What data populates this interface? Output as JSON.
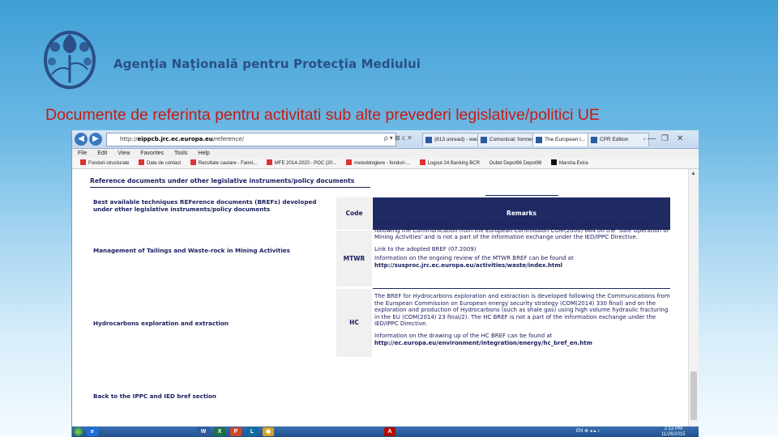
{
  "header": {
    "agency_name": "Agenţia Naţională pentru Protecţia Mediului"
  },
  "slide": {
    "title": "Documente de referinta pentru activitati sub alte prevederi legislative/politici UE"
  },
  "browser": {
    "url_prefix": "http://",
    "url_host": "eippcb.jrc.ec.europa.eu",
    "url_path": "/reference/",
    "url_controls": "ρ ▾ ⊠ c ✕",
    "tabs": [
      {
        "label": "(813 unread) - wed"
      },
      {
        "label": "Comunicat: former I..."
      },
      {
        "label": "The European I..."
      },
      {
        "label": "CPR Edition"
      }
    ],
    "window_controls": [
      "—",
      "❐",
      "✕"
    ],
    "menu": [
      "File",
      "Edit",
      "View",
      "Favorites",
      "Tools",
      "Help"
    ],
    "favorites": [
      "Fonduri-structurale",
      "Date de contact",
      "Rezultate cautare - Fanni...",
      "MFE 2014-2020 - POC (20...",
      "metodologiere - fonduri-...",
      "Logout 24 Banking BCR",
      "Outlet Depot96 Depot96",
      "Marsha Extra"
    ]
  },
  "page": {
    "heading": "Reference documents under other legislative instruments/policy documents",
    "bref_label": "Best available techniques REFerence documents (BREFs) developed under other legislative instruments/policy documents",
    "table_headers": {
      "code": "Code",
      "remarks": "Remarks"
    },
    "rows": [
      {
        "label": "Management of Tailings and Waste-rock in Mining Activities",
        "code": "MTWR",
        "remarks_1": "The BREF for Management of Tailings and Waste-Rock in Mining Activities (MTWR) was developed following the Communication from the European Commission COM(2000) 664 on the 'Safe Operation of Mining Activities' and is not a part of the information exchange under the IED/IPPC Directive.",
        "remarks_2": "Link to the adopted BREF (07.2009)",
        "remarks_3": "Information on the ongoing review of the MTWR BREF can be found at",
        "link": "http://susproc.jrc.ec.europa.eu/activities/waste/index.html"
      },
      {
        "label": "Hydrocarbons exploration and extraction",
        "code": "HC",
        "remarks_1": "The BREF for Hydrocarbons exploration and extraction is developed following the Communications from the European Commission on European energy security strategy (COM(2014) 330 final) and on the exploration and production of Hydrocarbons (such as shale gas) using high volume hydraulic fracturing in the EU (COM(2014) 23 final/2). The HC BREF is not a part of the information exchange under the IED/IPPC Directive.",
        "remarks_2": "Information on the drawing up of the HC BREF can be found at",
        "link": "http://ec.europa.eu/environment/integration/energy/hc_bref_en.htm"
      }
    ],
    "back_link": "Back to the IPPC and IED bref section"
  },
  "taskbar": {
    "apps": [
      "e",
      "W",
      "X",
      "P",
      "L",
      "◉",
      "A"
    ],
    "language": "EN",
    "tray_icons": "⊕ ◂ ▴ ♪",
    "time": "2:12 PM",
    "date": "11/26/2015"
  }
}
